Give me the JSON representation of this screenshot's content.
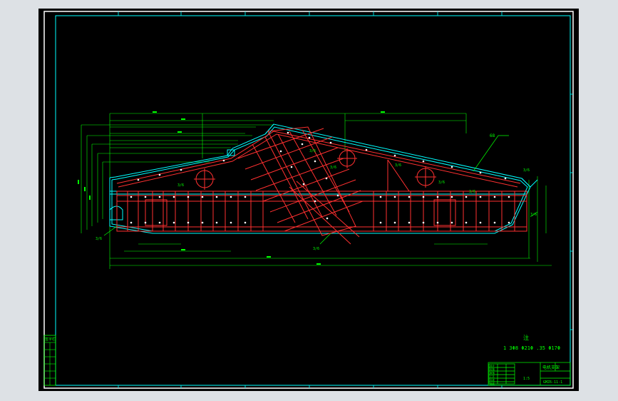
{
  "note": {
    "heading": "注",
    "line": "1 3Φ8 Φ21Φ .35 Φ17Φ"
  },
  "callouts": {
    "leader_label": "68",
    "weld_marks": [
      "3/6",
      "3/6",
      "3/6",
      "3/6",
      "3/6",
      "3/6",
      "3/6",
      "3/6",
      "3/6",
      "3/6"
    ]
  },
  "title_block": {
    "cells": [
      "设计",
      "校核",
      "审核",
      "工艺",
      "标准",
      "批准"
    ],
    "part_name": "电机支架",
    "part_code": "GMZ6-11-1",
    "scale": "1:5"
  },
  "side_panel": {
    "header": "签字栏"
  },
  "colors": {
    "border": "#ffffff",
    "frame": "#00ffff",
    "outline": "#00ffff",
    "dimension": "#00ff00",
    "weld": "#ff0000",
    "hole": "#ffffff",
    "viewport_bg": "#000000",
    "app_bg": "#dde1e5"
  }
}
